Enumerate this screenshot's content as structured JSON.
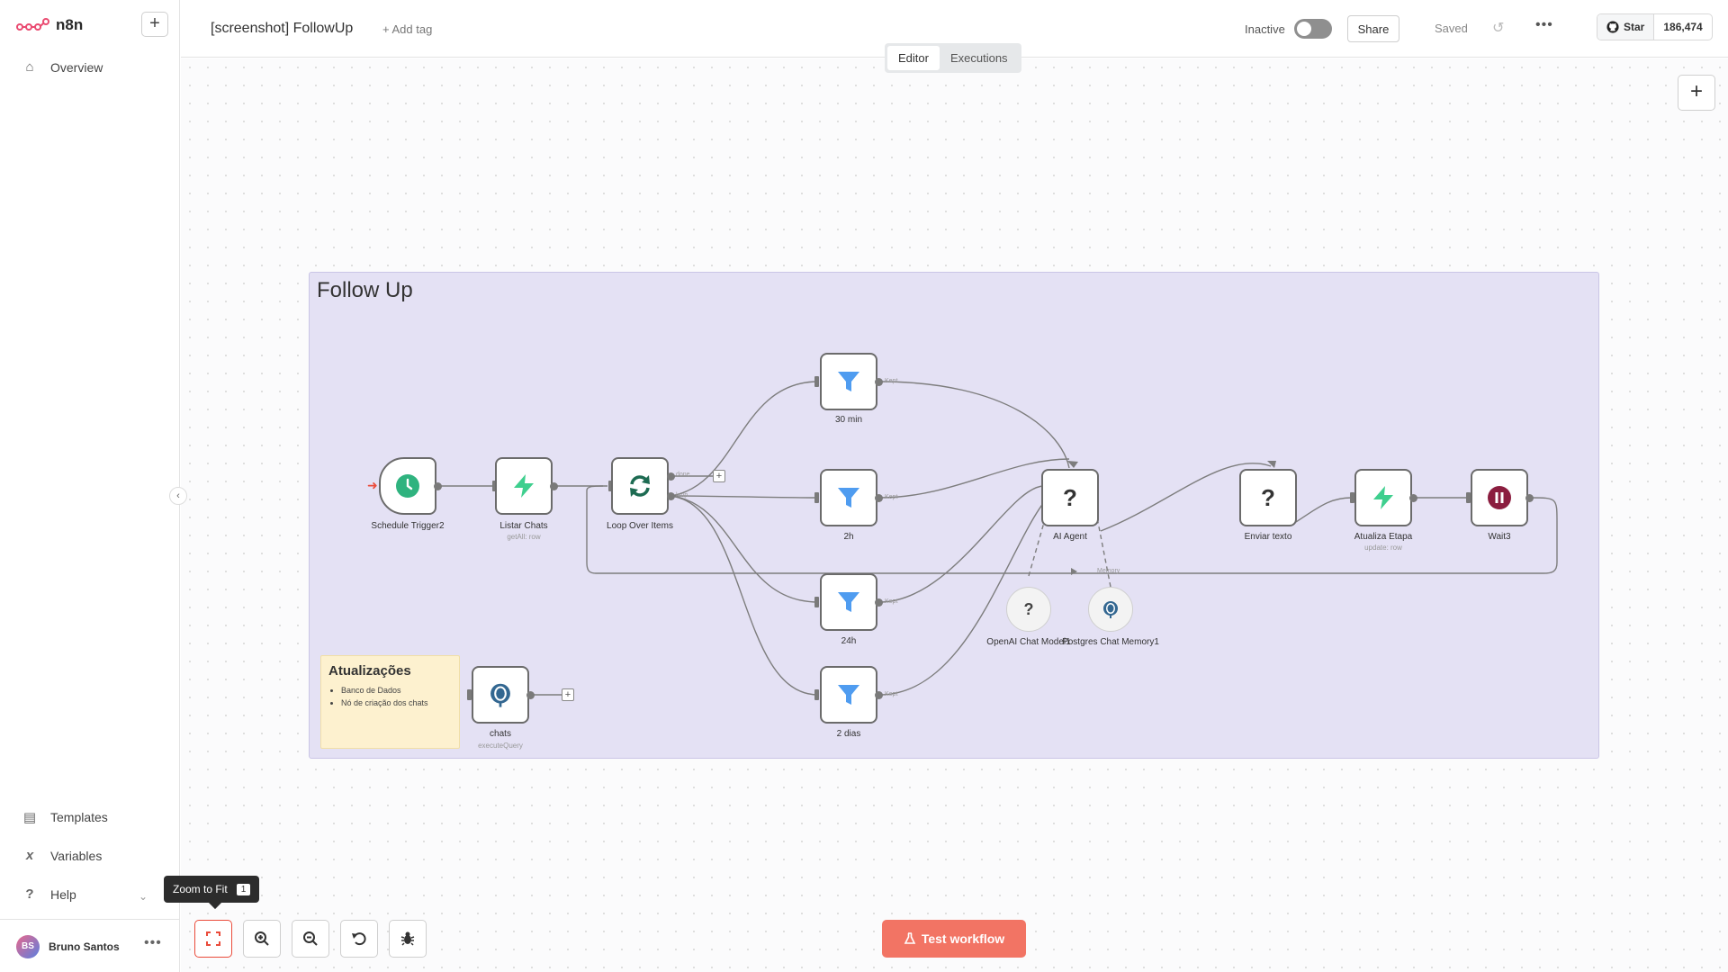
{
  "app": {
    "brand": "n8n"
  },
  "sidebar": {
    "items": [
      {
        "label": "Overview",
        "icon": "home-icon"
      },
      {
        "label": "Templates",
        "icon": "templates-icon"
      },
      {
        "label": "Variables",
        "icon": "variables-icon"
      },
      {
        "label": "Help",
        "icon": "help-icon"
      }
    ],
    "user": {
      "initials": "BS",
      "name": "Bruno Santos"
    }
  },
  "header": {
    "workflow_name": "[screenshot] FollowUp",
    "add_tag": "+ Add tag",
    "status_label": "Inactive",
    "share_label": "Share",
    "saved_label": "Saved",
    "github_star": "Star",
    "github_count": "186,474"
  },
  "tabs": {
    "editor": "Editor",
    "executions": "Executions"
  },
  "canvas": {
    "group_title": "Follow Up",
    "sticky": {
      "title": "Atualizações",
      "items": [
        "Banco de Dados",
        "Nó de criação dos chats"
      ]
    },
    "nodes": {
      "schedule": {
        "label": "Schedule Trigger2"
      },
      "listar": {
        "label": "Listar Chats",
        "sub": "getAll: row"
      },
      "loop": {
        "label": "Loop Over Items",
        "done": "done",
        "loop": "loop"
      },
      "f30": {
        "label": "30 min"
      },
      "f2h": {
        "label": "2h"
      },
      "f24h": {
        "label": "24h"
      },
      "f2d": {
        "label": "2 dias"
      },
      "agent": {
        "label": "AI Agent"
      },
      "openai": {
        "label": "OpenAI Chat Model1"
      },
      "postgres_mem": {
        "label": "Postgres Chat Memory1",
        "port": "Memory"
      },
      "enviar": {
        "label": "Enviar texto"
      },
      "atualiza": {
        "label": "Atualiza Etapa",
        "sub": "update: row"
      },
      "wait": {
        "label": "Wait3"
      },
      "chats": {
        "label": "chats",
        "sub": "executeQuery"
      },
      "kept": "Kept"
    }
  },
  "toolbar": {
    "tooltip": "Zoom to Fit",
    "tooltip_key": "1",
    "test_label": "Test workflow"
  },
  "colors": {
    "accent": "#ea4b3a",
    "test_button": "#f27464",
    "group_bg": "#e4e1f4",
    "sticky_bg": "#fdf1cf",
    "filter_icon": "#4f9cf0",
    "supabase_icon": "#3ecf8e",
    "wait_icon": "#8b1d3f"
  }
}
